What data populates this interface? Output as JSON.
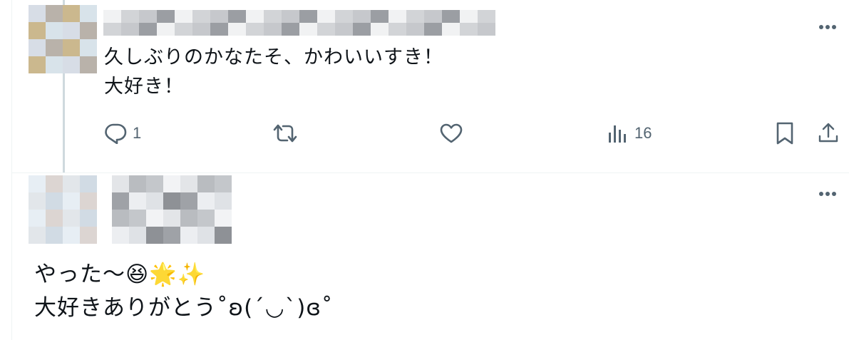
{
  "post1": {
    "text": "久しぶりのかなたそ、かわいいすき！\n大好き！",
    "actions": {
      "reply_count": "1",
      "retweet_count": "",
      "like_count": "",
      "views_count": "16"
    },
    "icons": [
      "reply-icon",
      "retweet-icon",
      "like-icon",
      "views-icon",
      "bookmark-icon",
      "share-icon",
      "more-icon"
    ]
  },
  "post2": {
    "text": "やった〜😆🌟✨\n大好きありがとう˚ʚ(´◡`)ɞ˚",
    "icons": [
      "more-icon"
    ]
  },
  "colors": {
    "text": "#0f1419",
    "icon": "#536471",
    "thread_line": "#cfd9de",
    "divider": "#eff3f4"
  }
}
